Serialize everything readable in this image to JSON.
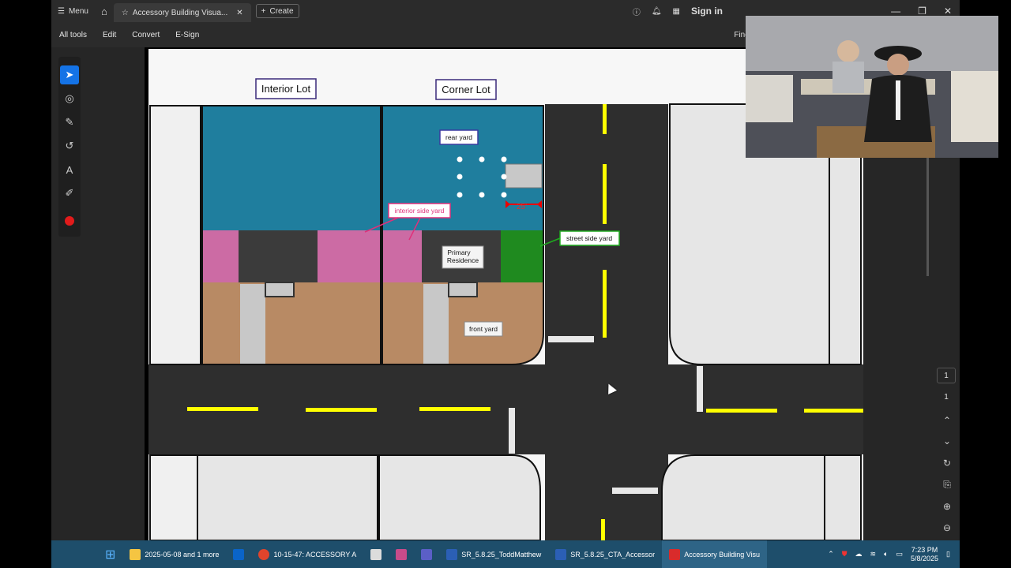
{
  "tabbar": {
    "menu_label": "Menu",
    "tab_title": "Accessory Building Visua...",
    "create_label": "Create",
    "signin_label": "Sign in"
  },
  "toolbar": {
    "items": [
      "All tools",
      "Edit",
      "Convert",
      "E-Sign"
    ],
    "find_label": "Find text or tools"
  },
  "diagram": {
    "lot_labels": {
      "interior": "Interior Lot",
      "corner": "Corner Lot"
    },
    "labels": {
      "rear_yard": "rear yard",
      "interior_side_yard": "interior side yard",
      "street_side_yard": "street side yard",
      "primary_residence_1": "Primary",
      "primary_residence_2": "Residence",
      "front_yard": "front yard",
      "setback": "25'"
    },
    "colors": {
      "rear": "#1f7e9e",
      "pink": "#cc6ba4",
      "green": "#1f8a1f",
      "tan": "#b88a64",
      "road": "#2e2e2e",
      "yellow": "#ffff00"
    }
  },
  "right_panel": {
    "page_current": "1",
    "page_total": "1"
  },
  "taskbar": {
    "items": [
      "2025-05-08 and 1 more",
      "10-15-47: ACCESSORY A",
      "SR_5.8.25_ToddMatthew",
      "SR_5.8.25_CTA_Accessor",
      "Accessory Building Visu"
    ],
    "time": "7:23 PM",
    "date": "5/8/2025"
  }
}
